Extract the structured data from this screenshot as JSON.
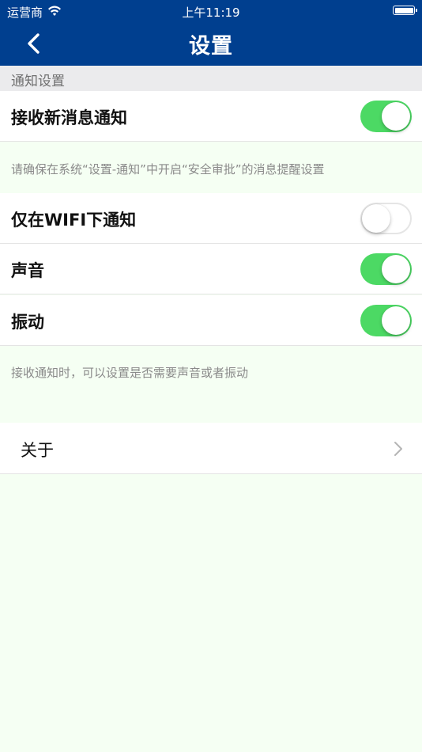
{
  "status_bar": {
    "carrier": "运营商",
    "time": "上午11:19"
  },
  "nav": {
    "title": "设置"
  },
  "section": {
    "header": "通知设置"
  },
  "rows": {
    "receive": {
      "label": "接收新消息通知",
      "on": true
    },
    "wifi_only": {
      "label": "仅在WIFI下通知",
      "on": false
    },
    "sound": {
      "label": "声音",
      "on": true
    },
    "vibrate": {
      "label": "振动",
      "on": true
    }
  },
  "notes": {
    "system_hint": "请确保在系统“设置-通知”中开启“安全审批”的消息提醒设置",
    "sound_hint": "接收通知时，可以设置是否需要声音或者振动"
  },
  "about": {
    "label": "关于"
  },
  "colors": {
    "nav_bg": "#003f8f",
    "toggle_on": "#4cd964",
    "page_bg": "#f5fff3"
  }
}
